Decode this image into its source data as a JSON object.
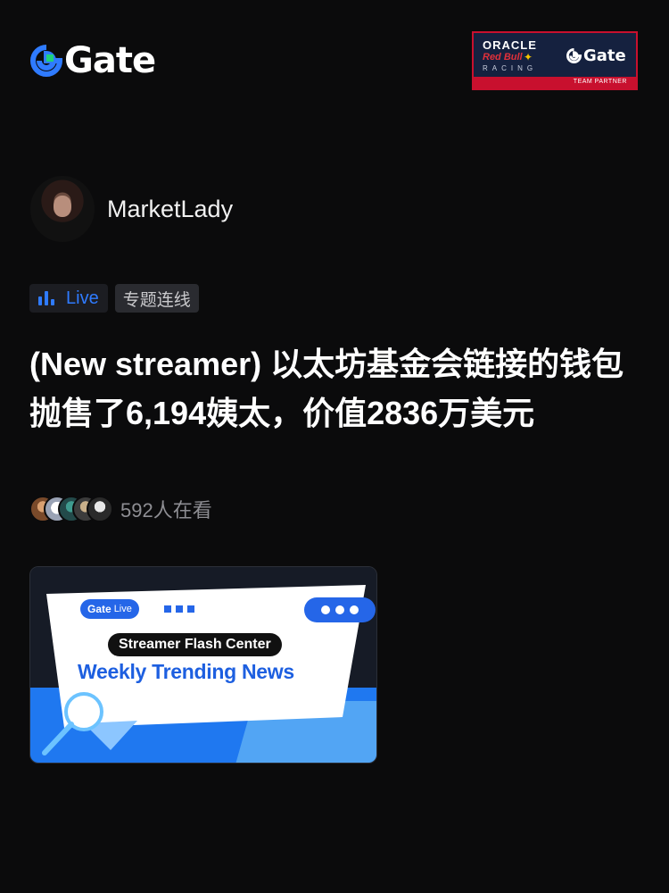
{
  "brand": {
    "name": "Gate",
    "accent": "#2f7bff",
    "mark_green": "#1fd17a"
  },
  "partner": {
    "oracle": "ORACLE",
    "redbull": "Red Bull",
    "racing": "RACING",
    "gate": "Gate",
    "team_partner": "TEAM PARTNER"
  },
  "author": {
    "name": "MarketLady"
  },
  "tags": {
    "live": "Live",
    "topic": "专题连线"
  },
  "post": {
    "headline": "(New streamer) 以太坊基金会链接的钱包抛售了6,194姨太，价值2836万美元",
    "viewers": "592人在看"
  },
  "banner": {
    "badge": "Gate",
    "badge_live": "Live",
    "pill": "Streamer Flash Center",
    "title": "Weekly Trending News"
  }
}
